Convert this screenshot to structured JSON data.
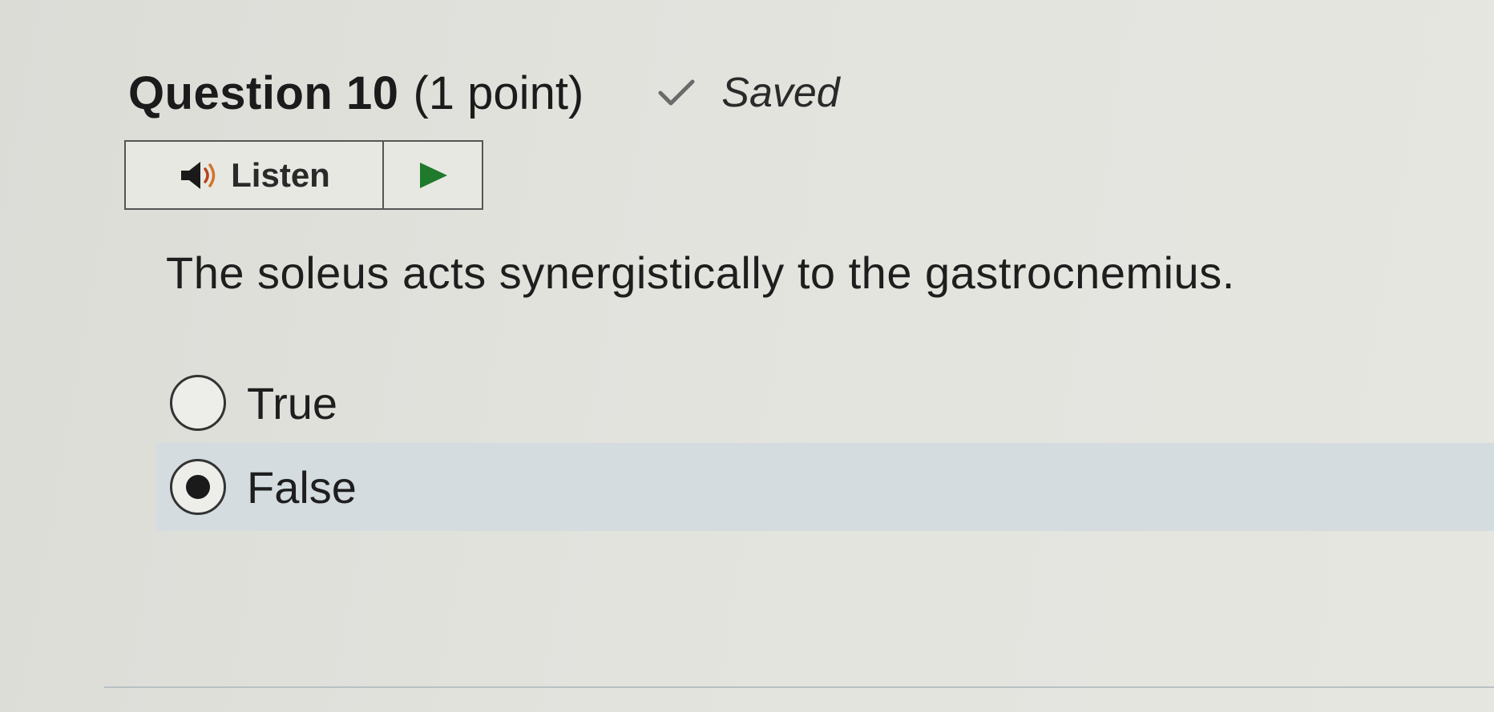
{
  "question": {
    "title": "Question 10",
    "points": "(1 point)",
    "status": "Saved",
    "text": "The soleus acts synergistically to the gastrocnemius."
  },
  "listen": {
    "label": "Listen",
    "speaker_icon": "speaker-icon",
    "play_icon": "play-icon",
    "play_color": "#1f7a2c"
  },
  "options": [
    {
      "label": "True",
      "selected": false
    },
    {
      "label": "False",
      "selected": true
    }
  ],
  "colors": {
    "selected_row": "#d5dcdf",
    "check_mark": "#6a6a6a"
  }
}
